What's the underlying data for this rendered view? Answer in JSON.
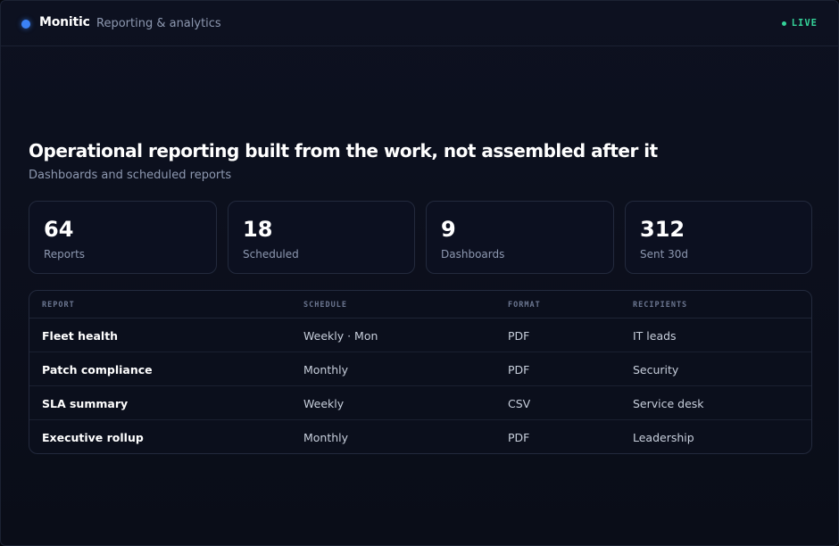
{
  "header": {
    "brand": "Monitic",
    "subtitle": "Reporting & analytics",
    "status": "LIVE"
  },
  "hero": {
    "title": "Operational reporting built from the work, not assembled after it",
    "subtitle": "Dashboards and scheduled reports"
  },
  "stats": [
    {
      "value": "64",
      "label": "Reports"
    },
    {
      "value": "18",
      "label": "Scheduled"
    },
    {
      "value": "9",
      "label": "Dashboards"
    },
    {
      "value": "312",
      "label": "Sent 30d"
    }
  ],
  "table": {
    "columns": [
      "REPORT",
      "SCHEDULE",
      "FORMAT",
      "RECIPIENTS"
    ],
    "rows": [
      {
        "report": "Fleet health",
        "schedule": "Weekly · Mon",
        "format": "PDF",
        "recipients": "IT leads"
      },
      {
        "report": "Patch compliance",
        "schedule": "Monthly",
        "format": "PDF",
        "recipients": "Security"
      },
      {
        "report": "SLA summary",
        "schedule": "Weekly",
        "format": "CSV",
        "recipients": "Service desk"
      },
      {
        "report": "Executive rollup",
        "schedule": "Monthly",
        "format": "PDF",
        "recipients": "Leadership"
      }
    ]
  },
  "colors": {
    "accent": "#3b82f6",
    "live": "#34d399",
    "background": "#0b0f1c"
  }
}
